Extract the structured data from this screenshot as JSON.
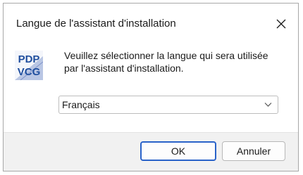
{
  "window": {
    "title": "Langue de l'assistant d'installation"
  },
  "logo": {
    "line1": "PDP",
    "line2": "VCG"
  },
  "message": {
    "line1": "Veuillez sélectionner la langue qui sera utilisée",
    "line2": "par l'assistant d'installation."
  },
  "language_select": {
    "selected": "Français"
  },
  "buttons": {
    "ok": "OK",
    "cancel": "Annuler"
  },
  "colors": {
    "accent_border": "#2a63c9",
    "footer_bg": "#f1f1f1",
    "logo_blue": "#1f4e9e"
  },
  "icons": {
    "close": "close-icon",
    "dropdown": "chevron-down-icon",
    "app": "app-logo-icon"
  }
}
